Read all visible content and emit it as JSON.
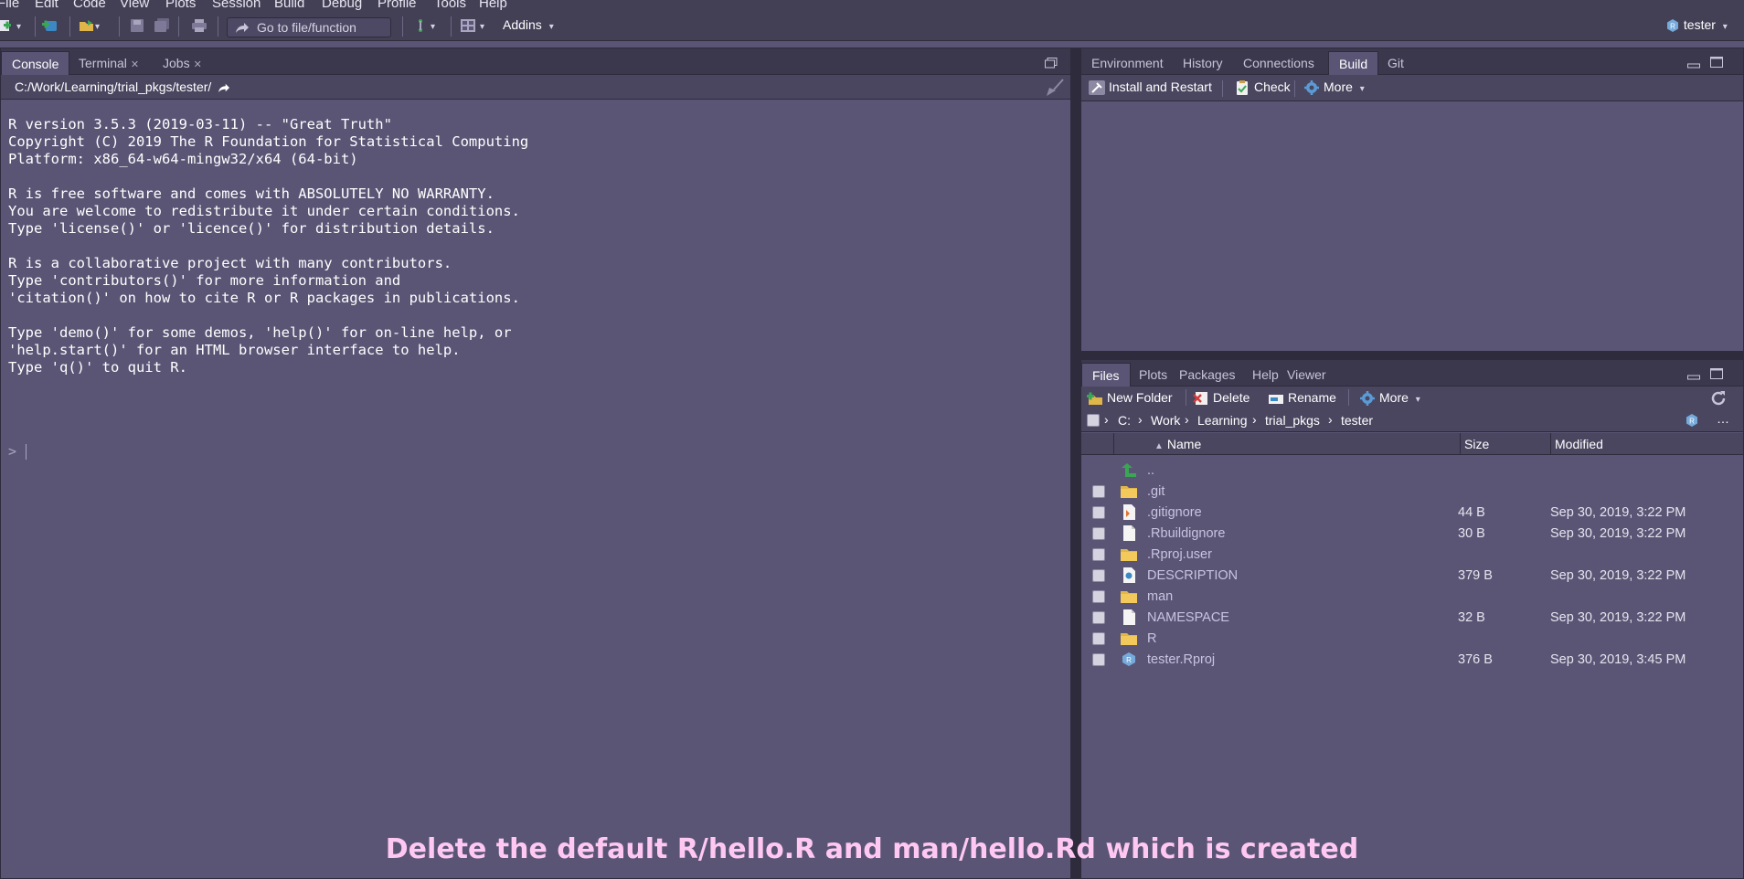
{
  "menu": [
    "File",
    "Edit",
    "Code",
    "View",
    "Plots",
    "Session",
    "Build",
    "Debug",
    "Profile",
    "Tools",
    "Help"
  ],
  "toolbar": {
    "goto_placeholder": "Go to file/function",
    "addins_label": "Addins",
    "user_label": "tester"
  },
  "console_pane": {
    "tabs": [
      "Console",
      "Terminal",
      "Jobs"
    ],
    "path": "C:/Work/Learning/trial_pkgs/tester/",
    "output": "R version 3.5.3 (2019-03-11) -- \"Great Truth\"\nCopyright (C) 2019 The R Foundation for Statistical Computing\nPlatform: x86_64-w64-mingw32/x64 (64-bit)\n\nR is free software and comes with ABSOLUTELY NO WARRANTY.\nYou are welcome to redistribute it under certain conditions.\nType 'license()' or 'licence()' for distribution details.\n\nR is a collaborative project with many contributors.\nType 'contributors()' for more information and\n'citation()' on how to cite R or R packages in publications.\n\nType 'demo()' for some demos, 'help()' for on-line help, or\n'help.start()' for an HTML browser interface to help.\nType 'q()' to quit R.",
    "prompt": ">"
  },
  "build_pane": {
    "tabs": [
      "Environment",
      "History",
      "Connections",
      "Build",
      "Git"
    ],
    "install_label": "Install and Restart",
    "check_label": "Check",
    "more_label": "More"
  },
  "files_pane": {
    "tabs": [
      "Files",
      "Plots",
      "Packages",
      "Help",
      "Viewer"
    ],
    "new_folder_label": "New Folder",
    "delete_label": "Delete",
    "rename_label": "Rename",
    "more_label": "More",
    "breadcrumb": [
      "C:",
      "Work",
      "Learning",
      "trial_pkgs",
      "tester"
    ],
    "columns": [
      "Name",
      "Size",
      "Modified"
    ],
    "parent": "..",
    "rows": [
      {
        "name": ".git",
        "size": "",
        "modified": "",
        "icon": "folder-icon"
      },
      {
        "name": ".gitignore",
        "size": "44 B",
        "modified": "Sep 30, 2019, 3:22 PM",
        "icon": "gitignore-file-icon"
      },
      {
        "name": ".Rbuildignore",
        "size": "30 B",
        "modified": "Sep 30, 2019, 3:22 PM",
        "icon": "file-icon"
      },
      {
        "name": ".Rproj.user",
        "size": "",
        "modified": "",
        "icon": "folder-icon"
      },
      {
        "name": "DESCRIPTION",
        "size": "379 B",
        "modified": "Sep 30, 2019, 3:22 PM",
        "icon": "description-file-icon"
      },
      {
        "name": "man",
        "size": "",
        "modified": "",
        "icon": "folder-icon"
      },
      {
        "name": "NAMESPACE",
        "size": "32 B",
        "modified": "Sep 30, 2019, 3:22 PM",
        "icon": "file-icon"
      },
      {
        "name": "R",
        "size": "",
        "modified": "",
        "icon": "folder-icon"
      },
      {
        "name": "tester.Rproj",
        "size": "376 B",
        "modified": "Sep 30, 2019, 3:45 PM",
        "icon": "rproj-file-icon"
      }
    ]
  },
  "caption": "Delete the default R/hello.R and man/hello.Rd which is created"
}
